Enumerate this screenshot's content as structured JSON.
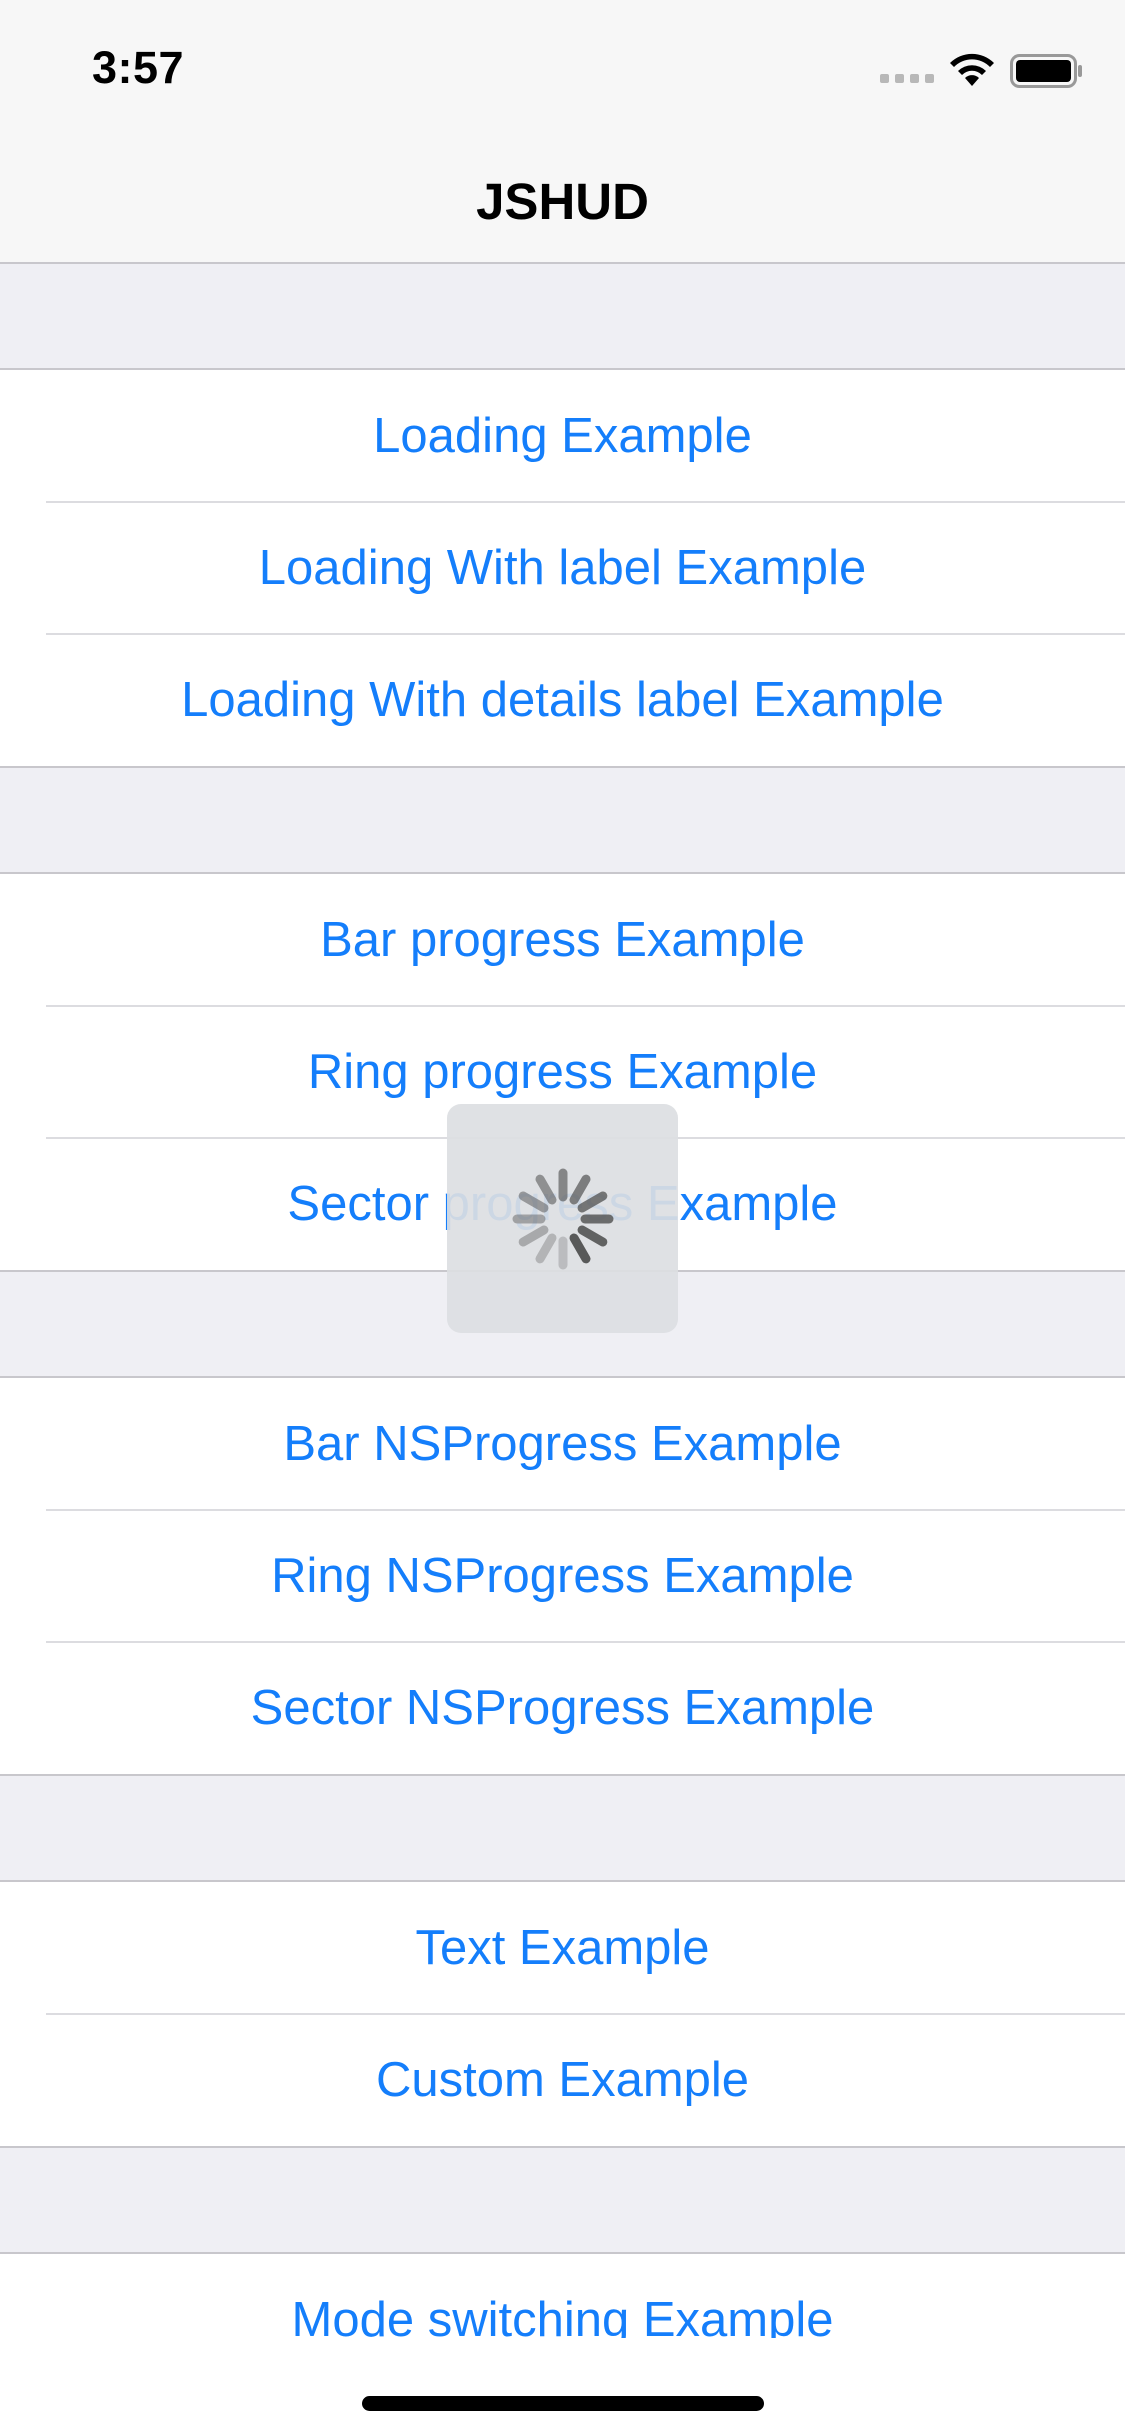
{
  "status_bar": {
    "time": "3:57",
    "icons": [
      "signal-icon",
      "wifi-icon",
      "battery-icon"
    ]
  },
  "nav": {
    "title": "JSHUD"
  },
  "colors": {
    "accent": "#147efb",
    "group_background": "#efeff4",
    "cell_background": "#ffffff",
    "separator": "#c8c7cc"
  },
  "sections": [
    {
      "rows": [
        "Loading Example",
        "Loading With label Example",
        "Loading With details label Example"
      ]
    },
    {
      "rows": [
        "Bar progress Example",
        "Ring progress Example",
        "Sector progress Example"
      ]
    },
    {
      "rows": [
        "Bar NSProgress Example",
        "Ring NSProgress Example",
        "Sector NSProgress Example"
      ]
    },
    {
      "rows": [
        "Text Example",
        "Custom Example"
      ]
    },
    {
      "rows": [
        "Mode switching Example"
      ]
    }
  ],
  "hud": {
    "icon": "activity-spinner-icon"
  }
}
